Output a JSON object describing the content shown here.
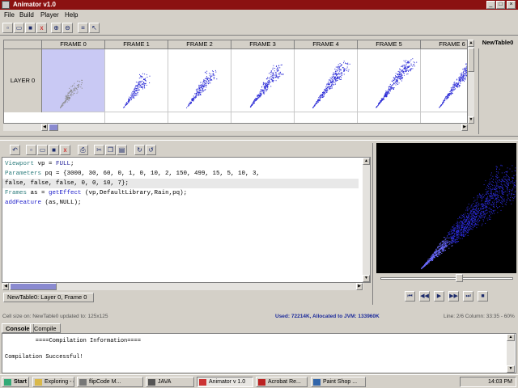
{
  "window": {
    "title": "Animator v1.0",
    "min": "_",
    "max": "□",
    "close": "×"
  },
  "menu": [
    "File",
    "Build",
    "Player",
    "Help"
  ],
  "toolbar_icons": [
    "new-icon",
    "open-icon",
    "save-icon",
    "delete-icon",
    "zoom-in-icon",
    "zoom-out-icon",
    "align-icon",
    "pointer-icon"
  ],
  "timeline": {
    "layer_label": "LAYER 0",
    "table_label": "NewTable0",
    "frames": [
      "FRAME 0",
      "FRAME 1",
      "FRAME 2",
      "FRAME 3",
      "FRAME 4",
      "FRAME 5",
      "FRAME 6"
    ],
    "selected_frame": 0
  },
  "editor": {
    "lines": [
      {
        "parts": [
          {
            "t": "Viewport",
            "c": "tp"
          },
          {
            "t": " vp = ",
            "c": ""
          },
          {
            "t": "FULL",
            "c": "kw"
          },
          {
            "t": ";",
            "c": ""
          }
        ]
      },
      {
        "parts": [
          {
            "t": "Parameters",
            "c": "tp"
          },
          {
            "t": " pq = {3000, 30, 60, 0, 1, 0, 10, 2, 150, 499, 15, 5, 10, 3,",
            "c": ""
          }
        ]
      },
      {
        "parts": [
          {
            "t": "false, false, false, 0, 0, 10, 7};",
            "c": ""
          }
        ],
        "highlight": true
      },
      {
        "parts": [
          {
            "t": "Frames",
            "c": "tp"
          },
          {
            "t": " as = ",
            "c": ""
          },
          {
            "t": "getEffect",
            "c": "fn"
          },
          {
            "t": " (vp,DefaultLibrary,Rain,pq);",
            "c": ""
          }
        ]
      },
      {
        "parts": [
          {
            "t": "addFeature",
            "c": "fn"
          },
          {
            "t": " (as,NULL);",
            "c": ""
          }
        ]
      }
    ],
    "tab_label": "NewTable0:  Layer 0, Frame 0"
  },
  "player": {
    "position": 0.58,
    "buttons": [
      "first-icon",
      "prev-icon",
      "play-icon",
      "next-icon",
      "last-icon",
      "stop-icon"
    ]
  },
  "status": {
    "left": "Cell size on: NewTable0 updated to: 125x125",
    "middle": "Used: 72214K, Allocated to JVM: 133960K",
    "right": "Line: 2/6  Column: 33:35 - 60%"
  },
  "tabs": [
    "Console",
    "Compile"
  ],
  "console": {
    "lines": [
      "         ====Compilation Information====",
      "",
      "Compilation Successful!"
    ]
  },
  "taskbar": {
    "start": "Start",
    "tasks": [
      "Exploring - c...",
      "flipCode M...",
      "JAVA",
      "Animator v 1.0",
      "Acrobat Re...",
      "Paint Shop ..."
    ],
    "active_task": 3,
    "clock": "14:03 PM"
  },
  "colors": {
    "title_bar": "#8b1111",
    "particles": "#2b2bd6",
    "selected_cell": "#c9c9f4",
    "ghost_particles": "#8a8a8a"
  }
}
